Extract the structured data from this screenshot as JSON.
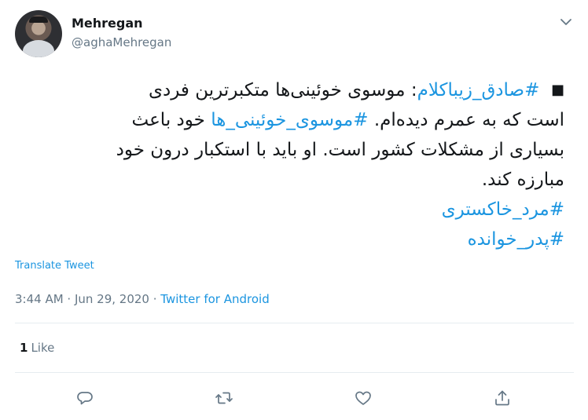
{
  "user": {
    "display_name": "Mehregan",
    "handle": "@aghaMehregan"
  },
  "tweet": {
    "bullet": "■",
    "line1_hashtag": "#صادق_زیباکلام",
    "line1_text": ": موسوی خوئینی‌ها متکبرترین فردی",
    "line2_text_a": "است که به عمرم دیده‌ام. ",
    "line2_hashtag": "#موسوی_خوئینی_ها",
    "line2_text_b": " خود باعث",
    "line3_text": "بسیاری از مشکلات کشور است. او باید با استکبار درون خود",
    "line4_text": "مبارزه کند.",
    "hashtag_3": "#مرد_خاکستری",
    "hashtag_4": "#پدر_خوانده"
  },
  "translate_label": "Translate Tweet",
  "meta": {
    "time": "3:44 AM",
    "separator": " · ",
    "date": "Jun 29, 2020",
    "source": "Twitter for Android"
  },
  "likes": {
    "count": "1",
    "label": "Like"
  },
  "actions": [
    "reply-icon",
    "retweet-icon",
    "like-icon",
    "share-icon"
  ],
  "colors": {
    "link": "#1b95e0",
    "secondary_text": "#657786",
    "divider": "#e6ecf0"
  }
}
